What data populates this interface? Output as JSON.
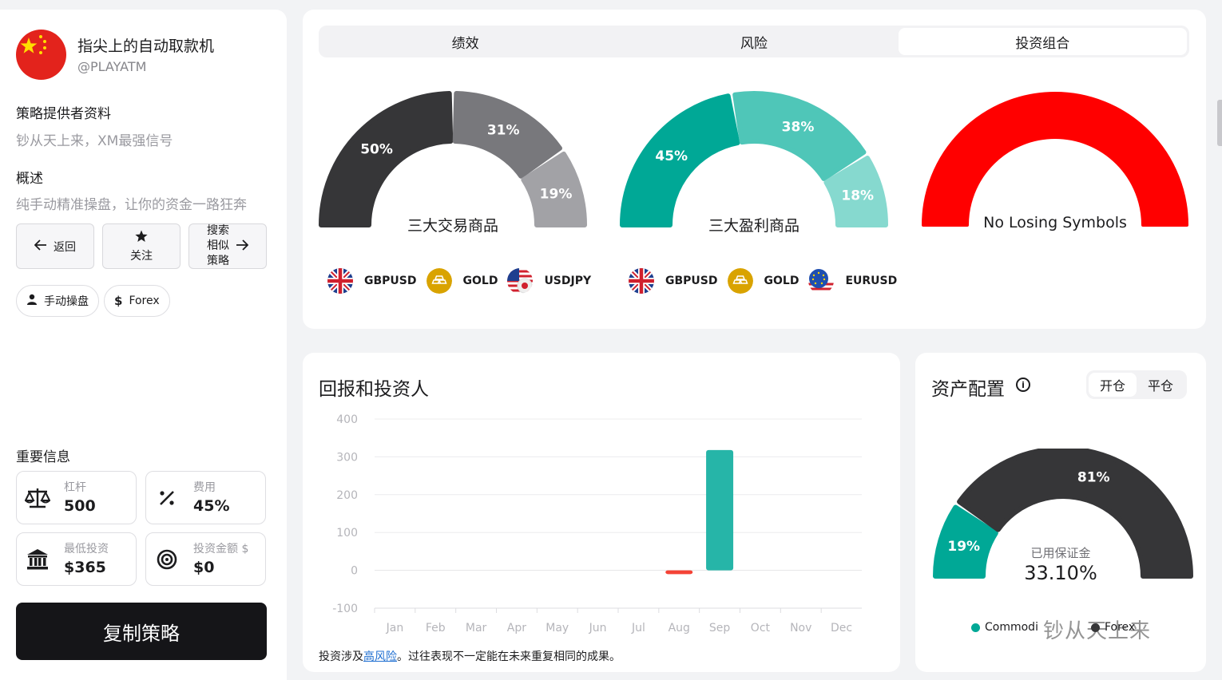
{
  "profile": {
    "name": "指尖上的自动取款机",
    "handle": "@PLAYATM",
    "provider_heading": "策略提供者资料",
    "provider_text": "钞从天上来，XM最强信号",
    "overview_heading": "概述",
    "overview_text": "纯手动精准操盘，让你的资金一路狂奔"
  },
  "actions": {
    "back": "返回",
    "follow": "关注",
    "search_similar": [
      "搜索",
      "相似",
      "策略"
    ]
  },
  "tags": {
    "manual": "手动操盘",
    "forex": "Forex"
  },
  "important": {
    "heading": "重要信息",
    "leverage_label": "杠杆",
    "leverage_value": "500",
    "fee_label": "费用",
    "fee_value": "45%",
    "min_invest_label": "最低投资",
    "min_invest_value": "$365",
    "invest_amount_label": "投资金额 $",
    "invest_amount_value": "$0"
  },
  "copy_button": "复制策略",
  "tabs": [
    "绩效",
    "风险",
    "投资组合"
  ],
  "gauges": {
    "traded": {
      "title": "三大交易商品",
      "slices": [
        {
          "label": "50%",
          "value": 50,
          "color": "#363638"
        },
        {
          "label": "31%",
          "value": 31,
          "color": "#78787c"
        },
        {
          "label": "19%",
          "value": 19,
          "color": "#a2a2a6"
        }
      ],
      "symbols": [
        "GBPUSD",
        "GOLD",
        "USDJPY"
      ]
    },
    "profitable": {
      "title": "三大盈利商品",
      "slices": [
        {
          "label": "45%",
          "value": 45,
          "color": "#00a896"
        },
        {
          "label": "38%",
          "value": 38,
          "color": "#4fc6b8"
        },
        {
          "label": "18%",
          "value": 18,
          "color": "#86d9cf"
        }
      ],
      "symbols": [
        "GBPUSD",
        "GOLD",
        "EURUSD"
      ]
    },
    "losing": {
      "title": "No Losing Symbols",
      "color": "#ff0000"
    }
  },
  "returns": {
    "title": "回报和投资人",
    "disclaimer_prefix": "投资涉及",
    "disclaimer_link": "高风险",
    "disclaimer_suffix": "。过往表现不一定能在未来重复相同的成果。"
  },
  "chart_data": {
    "type": "bar",
    "categories": [
      "Jan",
      "Feb",
      "Mar",
      "Apr",
      "May",
      "Jun",
      "Jul",
      "Aug",
      "Sep",
      "Oct",
      "Nov",
      "Dec"
    ],
    "values": [
      0,
      0,
      0,
      0,
      0,
      0,
      0,
      -10,
      318,
      0,
      0,
      0
    ],
    "colors": {
      "positive": "#26b5a8",
      "negative": "#f44336"
    },
    "ylim": [
      -100,
      400
    ],
    "yticks": [
      "400",
      "300",
      "200",
      "100",
      "0",
      "-100"
    ],
    "grid": true,
    "title": "",
    "xlabel": "",
    "ylabel": ""
  },
  "asset": {
    "title": "资产配置",
    "info_icon": "info-icon",
    "toggle": [
      "开仓",
      "平仓"
    ],
    "gauge_slices": [
      {
        "label": "19%",
        "value": 19,
        "color": "#00a896"
      },
      {
        "label": "81%",
        "value": 81,
        "color": "#363638"
      }
    ],
    "margin_label": "已用保证金",
    "margin_value": "33.10%",
    "legend_commodities": "Commodi",
    "legend_forex": "Forex"
  },
  "watermark": "钞从天上来"
}
